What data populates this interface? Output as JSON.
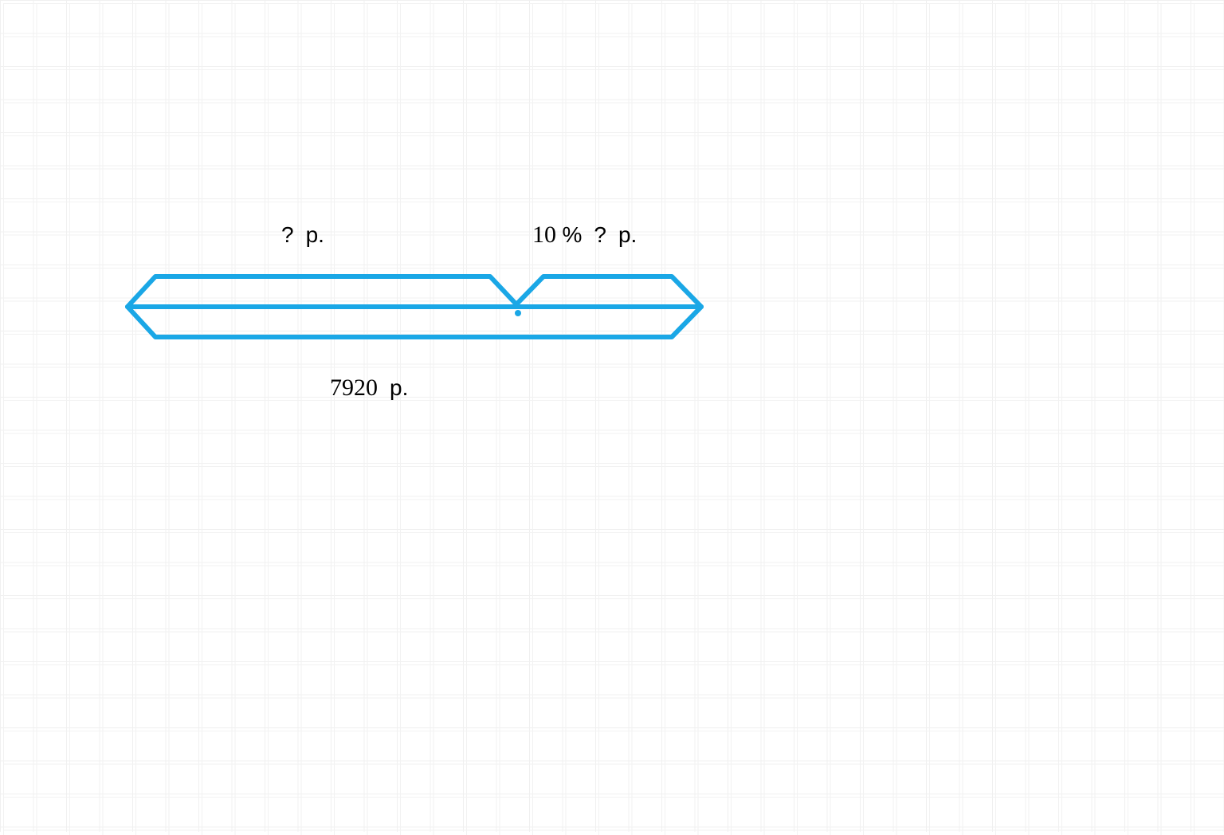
{
  "chart_data": {
    "type": "bar",
    "title": "",
    "xlabel": "",
    "ylabel": "",
    "segments": {
      "left": {
        "value_label": "? р.",
        "percent": null
      },
      "right": {
        "value_label": "? р.",
        "percent": 10
      }
    },
    "total": {
      "value": 7920,
      "unit": "р."
    }
  },
  "labels": {
    "top_left_q": "?",
    "top_left_unit": "р.",
    "top_right_num": "10",
    "top_right_pct": "%",
    "top_right_q": "?",
    "top_right_unit": "р.",
    "bottom_num": "7920",
    "bottom_unit": "р."
  },
  "colors": {
    "stroke": "#1aa7e6"
  }
}
